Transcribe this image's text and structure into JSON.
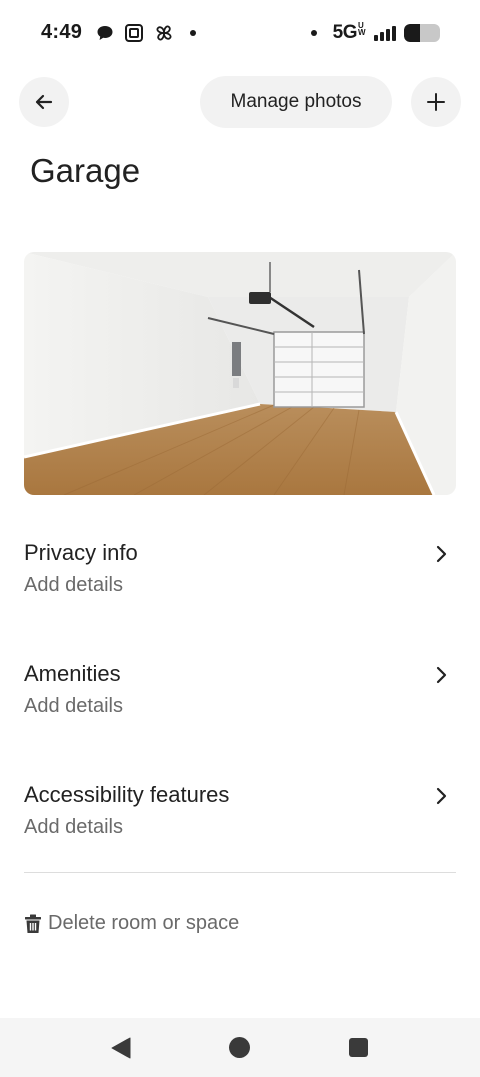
{
  "status_bar": {
    "time": "4:49",
    "network": "5G",
    "network_sub": "UW",
    "battery_level": 0.45,
    "signal_bars": 4
  },
  "nav": {
    "back_icon": "arrow-left-icon",
    "manage_photos_label": "Manage photos",
    "add_icon": "plus-icon"
  },
  "page": {
    "title": "Garage"
  },
  "rows": [
    {
      "title": "Privacy info",
      "subtitle": "Add details"
    },
    {
      "title": "Amenities",
      "subtitle": "Add details"
    },
    {
      "title": "Accessibility features",
      "subtitle": "Add details"
    }
  ],
  "delete": {
    "icon": "trash-icon",
    "label": "Delete room or space"
  },
  "colors": {
    "text_primary": "#222222",
    "text_secondary": "#6a6a6a",
    "button_bg": "#f2f2f2"
  }
}
